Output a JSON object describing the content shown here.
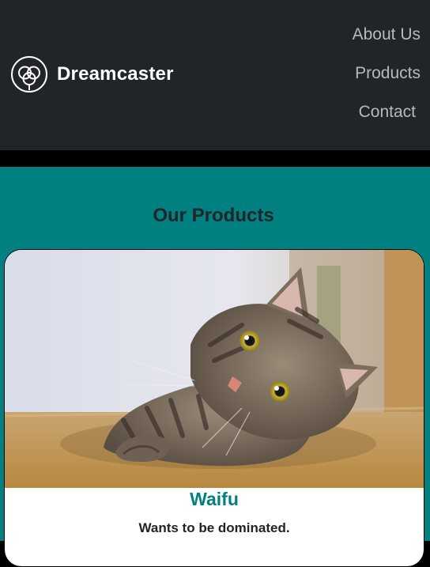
{
  "navbar": {
    "brand": "Dreamcaster",
    "logo_icon": "flower-logo-icon",
    "links": [
      "About Us",
      "Products",
      "Contact"
    ]
  },
  "main": {
    "title": "Our Products",
    "product": {
      "image": "tabby-cat-photo",
      "name": "Waifu",
      "description": "Wants to be dominated."
    }
  },
  "colors": {
    "header_bg": "#212529",
    "main_bg": "#008080",
    "accent": "#008080",
    "nav_link": "#b7b9bc"
  }
}
